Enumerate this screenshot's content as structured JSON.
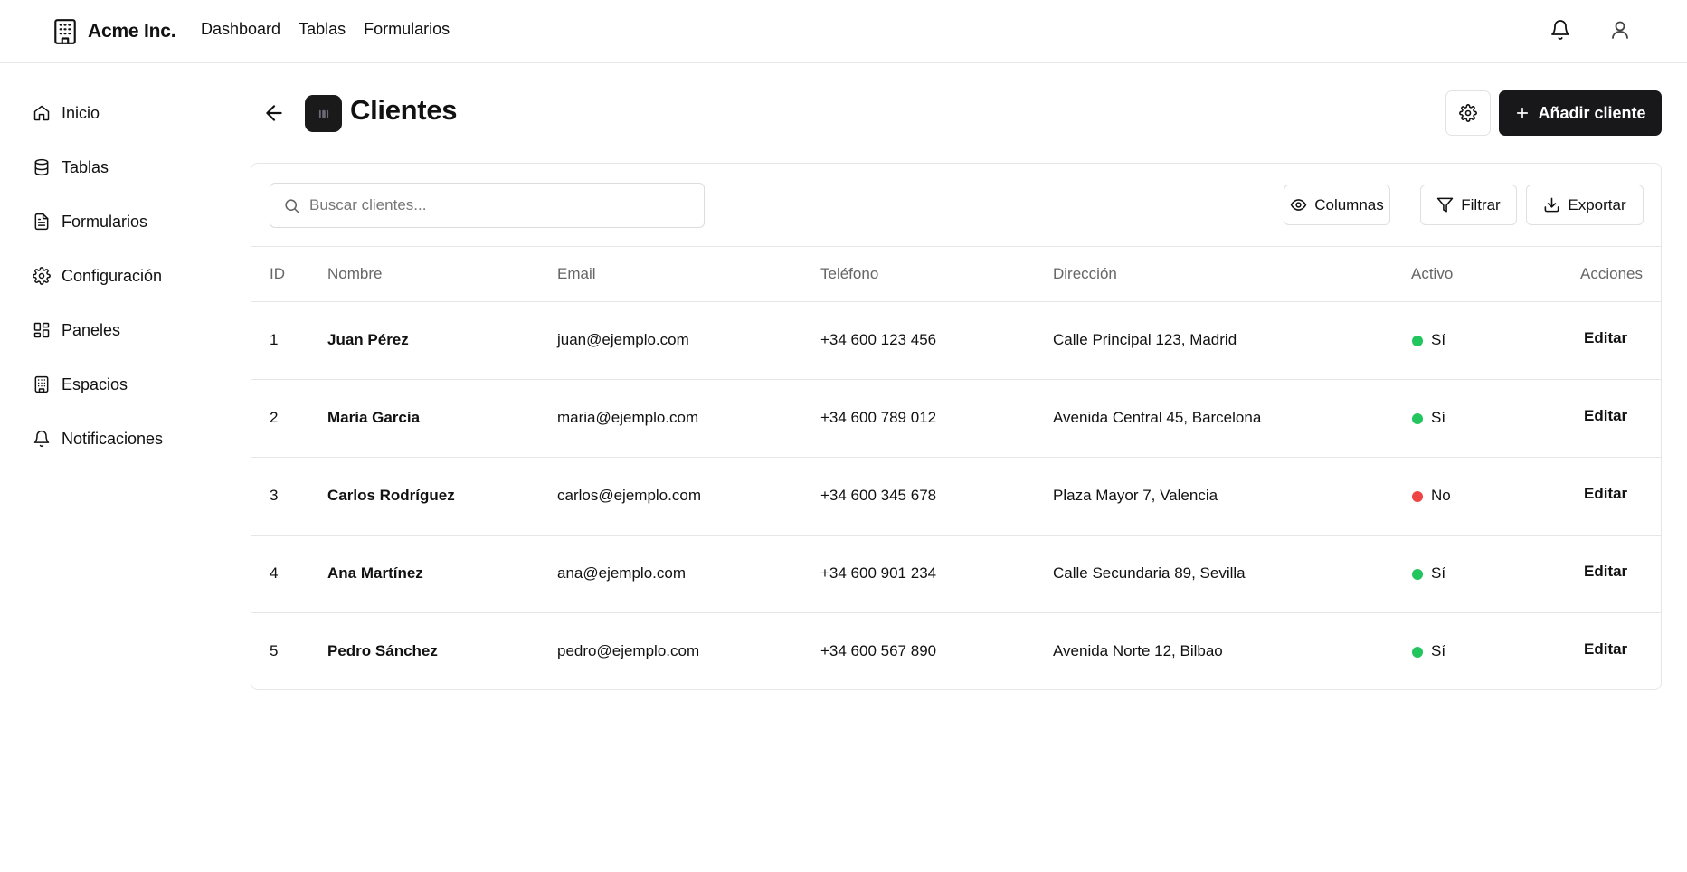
{
  "app": {
    "brand": "Acme Inc."
  },
  "topnav": [
    {
      "label": "Dashboard"
    },
    {
      "label": "Tablas"
    },
    {
      "label": "Formularios"
    }
  ],
  "sidebar": {
    "items": [
      {
        "label": "Inicio",
        "icon": "home-icon"
      },
      {
        "label": "Tablas",
        "icon": "database-icon"
      },
      {
        "label": "Formularios",
        "icon": "file-text-icon"
      },
      {
        "label": "Configuración",
        "icon": "gear-icon"
      },
      {
        "label": "Paneles",
        "icon": "layout-dashboard-icon"
      },
      {
        "label": "Espacios",
        "icon": "building-icon"
      },
      {
        "label": "Notificaciones",
        "icon": "bell-icon"
      }
    ]
  },
  "page": {
    "title": "Clientes",
    "add_label": "Añadir cliente"
  },
  "toolbar": {
    "search_placeholder": "Buscar clientes...",
    "columns_label": "Columnas",
    "filter_label": "Filtrar",
    "export_label": "Exportar"
  },
  "table": {
    "headers": [
      "ID",
      "Nombre",
      "Email",
      "Teléfono",
      "Dirección",
      "Activo",
      "Acciones"
    ],
    "rows": [
      {
        "id": "1",
        "name": "Juan Pérez",
        "email": "juan@ejemplo.com",
        "phone": "+34 600 123 456",
        "address": "Calle Principal 123, Madrid",
        "active": "Sí",
        "active_color": "#22c55e",
        "action": "Editar"
      },
      {
        "id": "2",
        "name": "María García",
        "email": "maria@ejemplo.com",
        "phone": "+34 600 789 012",
        "address": "Avenida Central 45, Barcelona",
        "active": "Sí",
        "active_color": "#22c55e",
        "action": "Editar"
      },
      {
        "id": "3",
        "name": "Carlos Rodríguez",
        "email": "carlos@ejemplo.com",
        "phone": "+34 600 345 678",
        "address": "Plaza Mayor 7, Valencia",
        "active": "No",
        "active_color": "#ef4444",
        "action": "Editar"
      },
      {
        "id": "4",
        "name": "Ana Martínez",
        "email": "ana@ejemplo.com",
        "phone": "+34 600 901 234",
        "address": "Calle Secundaria 89, Sevilla",
        "active": "Sí",
        "active_color": "#22c55e",
        "action": "Editar"
      },
      {
        "id": "5",
        "name": "Pedro Sánchez",
        "email": "pedro@ejemplo.com",
        "phone": "+34 600 567 890",
        "address": "Avenida Norte 12, Bilbao",
        "active": "Sí",
        "active_color": "#22c55e",
        "action": "Editar"
      }
    ]
  },
  "colors": {
    "primary": "#18181b",
    "border": "#e6e6e6",
    "active": "#22c55e",
    "inactive": "#ef4444"
  }
}
